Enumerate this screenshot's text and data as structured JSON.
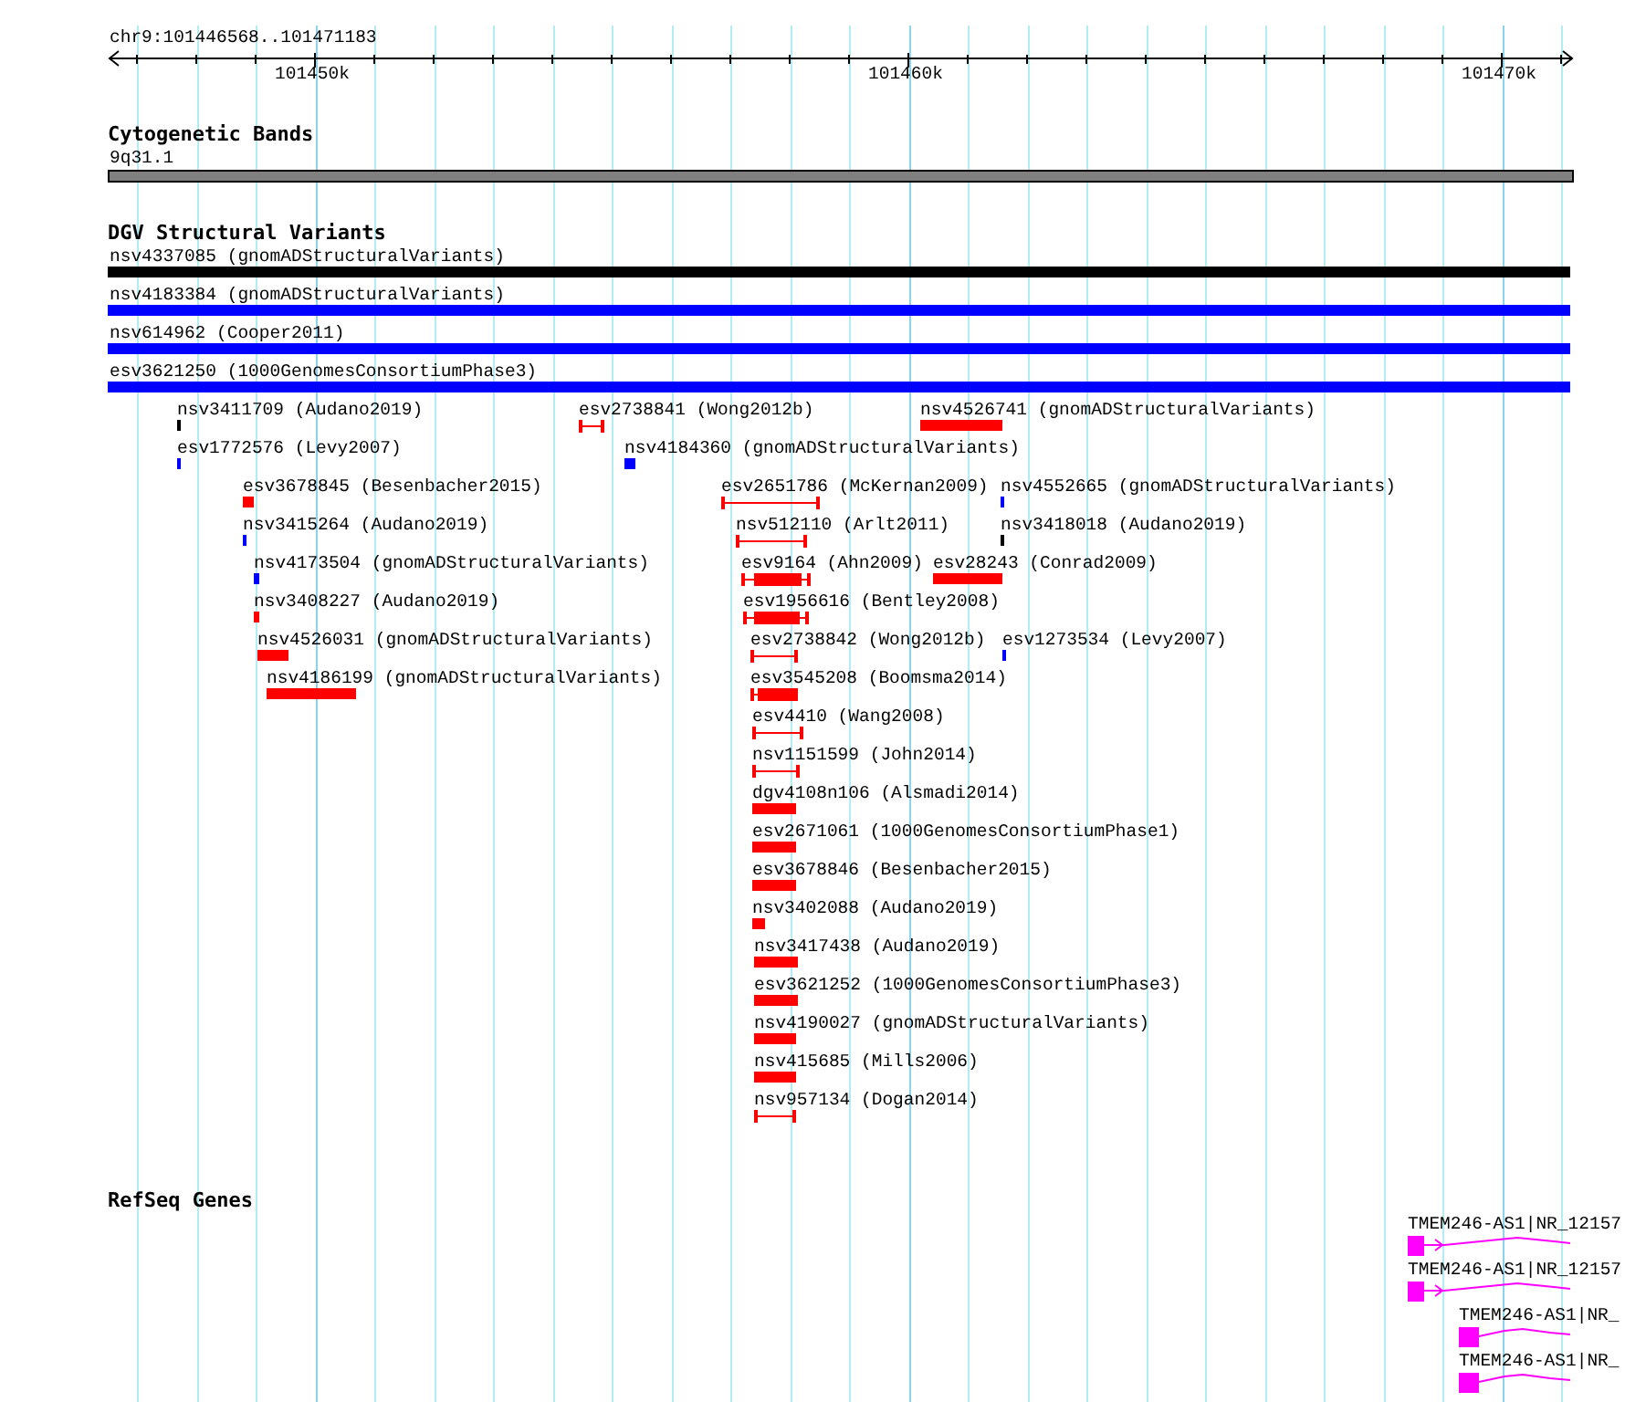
{
  "location": "chr9:101446568..101471183",
  "ruler": {
    "ticks": [
      "101450k",
      "101460k",
      "101470k"
    ]
  },
  "tracks": [
    {
      "kind": "bands",
      "title": "Cytogenetic Bands",
      "features": [
        {
          "label": "9q31.1",
          "color": "#808080"
        }
      ]
    },
    {
      "kind": "variants",
      "title": "DGV Structural Variants",
      "features": [
        {
          "label": "nsv4337085 (gnomADStructuralVariants)",
          "kind": "bar",
          "color": "#000000"
        },
        {
          "label": "nsv4183384 (gnomADStructuralVariants)",
          "kind": "bar",
          "color": "#0000ff"
        },
        {
          "label": "nsv614962 (Cooper2011)",
          "kind": "bar",
          "color": "#0000ff"
        },
        {
          "label": "esv3621250 (1000GenomesConsortiumPhase3)",
          "kind": "bar",
          "color": "#0000ff"
        },
        {
          "label": "nsv3411709 (Audano2019)",
          "kind": "bar",
          "color": "#000000"
        },
        {
          "label": "esv2738841 (Wong2012b)",
          "kind": "span",
          "color": "#ff0000"
        },
        {
          "label": "nsv4526741 (gnomADStructuralVariants)",
          "kind": "bar",
          "color": "#ff0000"
        },
        {
          "label": "esv1772576 (Levy2007)",
          "kind": "bar",
          "color": "#0000ff"
        },
        {
          "label": "nsv4184360 (gnomADStructuralVariants)",
          "kind": "bar",
          "color": "#0000ff"
        },
        {
          "label": "esv3678845 (Besenbacher2015)",
          "kind": "bar",
          "color": "#ff0000"
        },
        {
          "label": "esv2651786 (McKernan2009)",
          "kind": "span",
          "color": "#ff0000"
        },
        {
          "label": "nsv4552665 (gnomADStructuralVariants)",
          "kind": "bar",
          "color": "#0000ff"
        },
        {
          "label": "nsv3415264 (Audano2019)",
          "kind": "bar",
          "color": "#0000ff"
        },
        {
          "label": "nsv512110 (Arlt2011)",
          "kind": "span",
          "color": "#ff0000"
        },
        {
          "label": "nsv3418018 (Audano2019)",
          "kind": "bar",
          "color": "#000000"
        },
        {
          "label": "nsv4173504 (gnomADStructuralVariants)",
          "kind": "bar",
          "color": "#0000ff"
        },
        {
          "label": "esv9164 (Ahn2009)",
          "kind": "span-core",
          "color": "#ff0000"
        },
        {
          "label": "esv28243 (Conrad2009)",
          "kind": "bar",
          "color": "#ff0000"
        },
        {
          "label": "nsv3408227 (Audano2019)",
          "kind": "bar",
          "color": "#ff0000"
        },
        {
          "label": "esv1956616 (Bentley2008)",
          "kind": "span-core",
          "color": "#ff0000"
        },
        {
          "label": "nsv4526031 (gnomADStructuralVariants)",
          "kind": "bar",
          "color": "#ff0000"
        },
        {
          "label": "esv2738842 (Wong2012b)",
          "kind": "span",
          "color": "#ff0000"
        },
        {
          "label": "esv1273534 (Levy2007)",
          "kind": "bar",
          "color": "#0000ff"
        },
        {
          "label": "nsv4186199 (gnomADStructuralVariants)",
          "kind": "bar",
          "color": "#ff0000"
        },
        {
          "label": "esv3545208 (Boomsma2014)",
          "kind": "span-core",
          "color": "#ff0000"
        },
        {
          "label": "esv4410 (Wang2008)",
          "kind": "span",
          "color": "#ff0000"
        },
        {
          "label": "nsv1151599 (John2014)",
          "kind": "span",
          "color": "#ff0000"
        },
        {
          "label": "dgv4108n106 (Alsmadi2014)",
          "kind": "bar",
          "color": "#ff0000"
        },
        {
          "label": "esv2671061 (1000GenomesConsortiumPhase1)",
          "kind": "bar",
          "color": "#ff0000"
        },
        {
          "label": "esv3678846 (Besenbacher2015)",
          "kind": "bar",
          "color": "#ff0000"
        },
        {
          "label": "nsv3402088 (Audano2019)",
          "kind": "bar",
          "color": "#ff0000"
        },
        {
          "label": "nsv3417438 (Audano2019)",
          "kind": "bar",
          "color": "#ff0000"
        },
        {
          "label": "esv3621252 (1000GenomesConsortiumPhase3)",
          "kind": "bar",
          "color": "#ff0000"
        },
        {
          "label": "nsv4190027 (gnomADStructuralVariants)",
          "kind": "bar",
          "color": "#ff0000"
        },
        {
          "label": "nsv415685 (Mills2006)",
          "kind": "bar",
          "color": "#ff0000"
        },
        {
          "label": "nsv957134 (Dogan2014)",
          "kind": "span",
          "color": "#ff0000"
        }
      ]
    },
    {
      "kind": "genes",
      "title": "RefSeq Genes",
      "features": [
        {
          "label": "TMEM246-AS1|NR_12157",
          "kind": "arrow"
        },
        {
          "label": "TMEM246-AS1|NR_12157",
          "kind": "arrow"
        },
        {
          "label": "TMEM246-AS1|NR_",
          "kind": "plain"
        },
        {
          "label": "TMEM246-AS1|NR_",
          "kind": "plain"
        }
      ]
    }
  ]
}
